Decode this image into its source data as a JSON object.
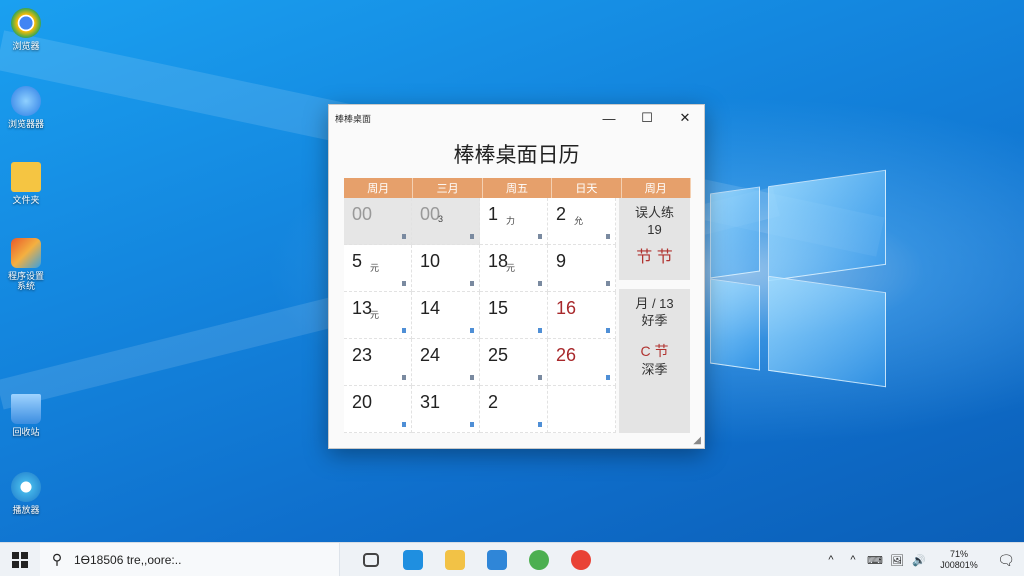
{
  "desktop": {
    "icons": [
      {
        "name": "chrome",
        "label": "浏览器",
        "color": "#e94235"
      },
      {
        "name": "browser-blue",
        "label": "浏览器器",
        "color": "#2a7be4"
      },
      {
        "name": "folder",
        "label": "文件夹",
        "color": "#f5c542"
      },
      {
        "name": "app",
        "label": "程序设置 系统",
        "color": "#e85a2a"
      },
      {
        "name": "recycle",
        "label": "回收站",
        "color": "#3b8de0"
      },
      {
        "name": "media",
        "label": "播放器",
        "color": "#43b4e8"
      }
    ]
  },
  "window": {
    "title": "棒棒桌面",
    "heading": "棒棒桌面日历",
    "minimize": "—",
    "maximize": "☐",
    "close": "✕",
    "resize_grip": "◢",
    "weekdays": [
      "周月",
      "三月",
      "周五",
      "日天",
      "周月"
    ],
    "rows": [
      [
        {
          "num": "00",
          "sub": "",
          "muted": true,
          "red": false,
          "mark": "gray"
        },
        {
          "num": "00",
          "sub": "3",
          "muted": true,
          "red": false,
          "mark": "gray"
        },
        {
          "num": "1",
          "sub": "力",
          "muted": false,
          "red": false,
          "mark": "gray"
        },
        {
          "num": "2",
          "sub": "允",
          "muted": false,
          "red": false,
          "mark": "gray"
        }
      ],
      [
        {
          "num": "5",
          "sub": "元",
          "muted": false,
          "red": false,
          "mark": "gray"
        },
        {
          "num": "10",
          "sub": "",
          "muted": false,
          "red": false,
          "mark": "gray"
        },
        {
          "num": "18",
          "sub": "元",
          "muted": false,
          "red": false,
          "mark": "gray"
        },
        {
          "num": "9",
          "sub": "",
          "muted": false,
          "red": false,
          "mark": "gray"
        }
      ],
      [
        {
          "num": "13",
          "sub": "元",
          "muted": false,
          "red": false,
          "mark": "blue"
        },
        {
          "num": "14",
          "sub": "",
          "muted": false,
          "red": false,
          "mark": "blue"
        },
        {
          "num": "15",
          "sub": "",
          "muted": false,
          "red": false,
          "mark": "blue"
        },
        {
          "num": "16",
          "sub": "",
          "muted": false,
          "red": true,
          "mark": "blue"
        }
      ],
      [
        {
          "num": "23",
          "sub": "",
          "muted": false,
          "red": false,
          "mark": "gray"
        },
        {
          "num": "24",
          "sub": "",
          "muted": false,
          "red": false,
          "mark": "gray"
        },
        {
          "num": "25",
          "sub": "",
          "muted": false,
          "red": false,
          "mark": "gray"
        },
        {
          "num": "26",
          "sub": "",
          "muted": false,
          "red": true,
          "mark": "blue"
        }
      ],
      [
        {
          "num": "20",
          "sub": "",
          "muted": false,
          "red": false,
          "mark": "blue"
        },
        {
          "num": "31",
          "sub": "",
          "muted": false,
          "red": false,
          "mark": "blue"
        },
        {
          "num": "2",
          "sub": "",
          "muted": false,
          "red": false,
          "mark": "blue"
        },
        {
          "num": "",
          "sub": "",
          "muted": false,
          "red": false,
          "mark": ""
        }
      ]
    ],
    "side_top": {
      "line1": "误人练",
      "line2": "19",
      "festival": "节 节"
    },
    "side_bottom": {
      "line1": "月 / 13",
      "line2": "好季",
      "festival": "C 节",
      "line3": "深季"
    }
  },
  "taskbar": {
    "start_icon": "windows-logo",
    "search_text": "1Ɵ18506 tre,,oore:..",
    "apps": [
      {
        "name": "task-view",
        "color": "#444"
      },
      {
        "name": "edge",
        "color": "#1f8fe0"
      },
      {
        "name": "file-explorer",
        "color": "#f2c246"
      },
      {
        "name": "store",
        "color": "#2f86d8"
      },
      {
        "name": "maps",
        "color": "#4caf50"
      },
      {
        "name": "chrome",
        "color": "#e94235"
      }
    ],
    "tray": [
      "^",
      "^",
      "⌨",
      "🖼",
      "🔊"
    ],
    "clock_line1": "71%",
    "clock_line2": "J00801%",
    "notification": "🗨"
  }
}
